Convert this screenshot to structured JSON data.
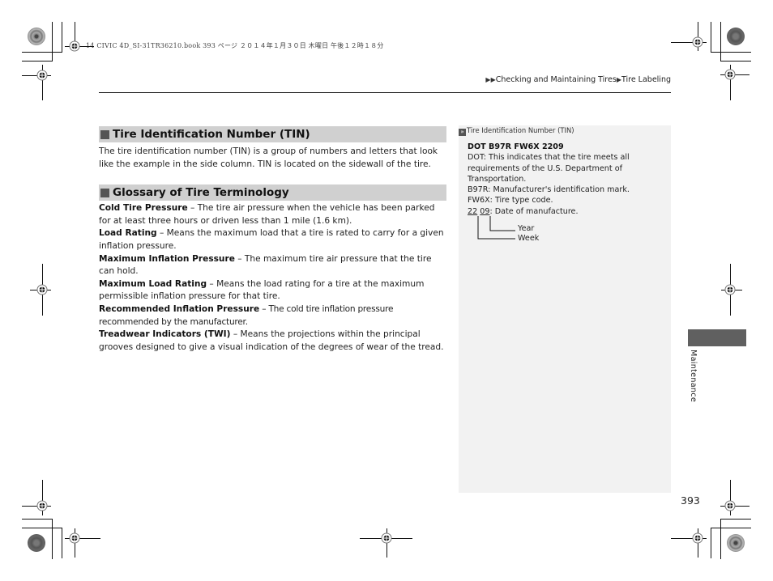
{
  "printer_header": "14 CIVIC 4D_SI-31TR36210.book  393 ページ  ２０１４年１月３０日  木曜日  午後１２時１８分",
  "breadcrumb": {
    "prefix_icon": "double-triangle-right-icon",
    "items": [
      "Checking and Maintaining Tires",
      "Tire Labeling"
    ],
    "separator_icon": "triangle-right-icon"
  },
  "main": {
    "tin_section": {
      "heading": "Tire Identification Number (TIN)",
      "body": "The tire identification number (TIN) is a group of numbers and letters that look like the example in the side column. TIN is located on the sidewall of the tire."
    },
    "glossary_section": {
      "heading": "Glossary of Tire Terminology",
      "entries": [
        {
          "term": "Cold Tire Pressure",
          "definition": " – The tire air pressure when the vehicle has been parked for at least three hours or driven less than 1 mile (1.6 km)."
        },
        {
          "term": "Load Rating",
          "definition": " – Means the maximum load that a tire is rated to carry for a given inflation pressure."
        },
        {
          "term": "Maximum Inflation Pressure",
          "definition": " – The maximum tire air pressure that the tire can hold."
        },
        {
          "term": "Maximum Load Rating",
          "definition": " – Means the load rating for a tire at the maximum permissible inflation pressure for that tire."
        },
        {
          "term": "Recommended Inflation Pressure",
          "definition": " – The cold tire inflation pressure recommended by the manufacturer."
        },
        {
          "term": "Treadwear Indicators (TWI)",
          "definition": " – Means the projections within the principal grooves designed to give a visual indication of the degrees of wear of the tread."
        }
      ]
    }
  },
  "side": {
    "ref_icon": "reference-arrow-icon",
    "ref_title": "Tire Identification Number (TIN)",
    "code": "DOT B97R FW6X 2209",
    "lines": [
      "DOT: This indicates that the tire meets all requirements of the U.S. Department of Transportation.",
      "B97R: Manufacturer's identification mark.",
      "FW6X: Tire type code."
    ],
    "date_line": {
      "week": "22",
      "year": "09",
      "rest": ": Date of manufacture."
    },
    "diagram_labels": {
      "year": "Year",
      "week": "Week"
    }
  },
  "tab": {
    "label": "Maintenance"
  },
  "page_number": "393"
}
